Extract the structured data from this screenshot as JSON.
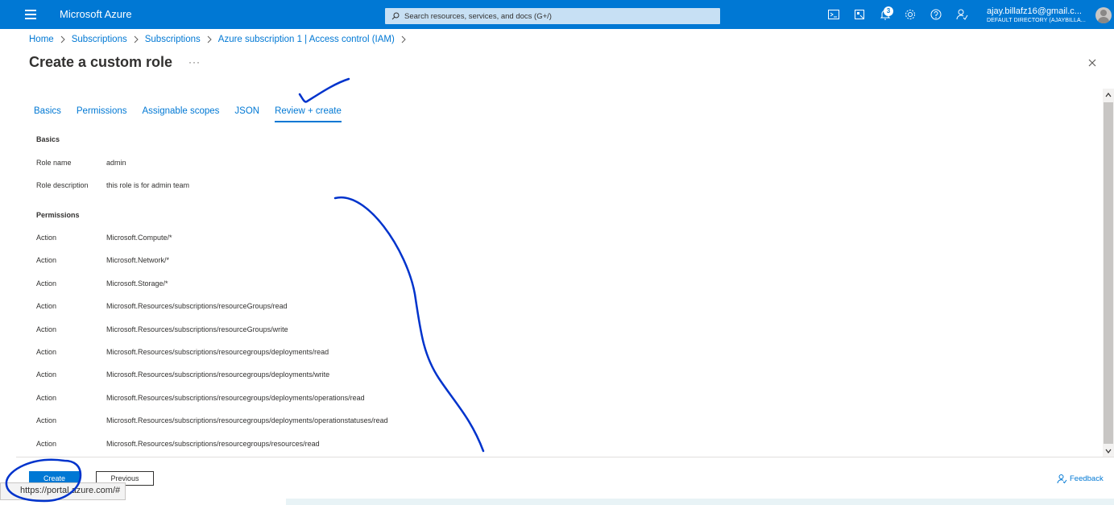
{
  "topbar": {
    "brand": "Microsoft Azure",
    "search_placeholder": "Search resources, services, and docs (G+/)",
    "notification_count": "3",
    "account_email": "ajay.billafz16@gmail.c...",
    "account_directory": "DEFAULT DIRECTORY (AJAYBILLA...",
    "icons": [
      "menu-icon",
      "search-icon",
      "cloud-shell-icon",
      "directory-filter-icon",
      "bell-icon",
      "gear-icon",
      "help-icon",
      "feedback-person-icon",
      "avatar"
    ]
  },
  "breadcrumb": [
    "Home",
    "Subscriptions",
    "Subscriptions",
    "Azure subscription 1 | Access control (IAM)"
  ],
  "page": {
    "title": "Create a custom role",
    "more": "···"
  },
  "tabs": [
    {
      "label": "Basics",
      "active": false
    },
    {
      "label": "Permissions",
      "active": false
    },
    {
      "label": "Assignable scopes",
      "active": false
    },
    {
      "label": "JSON",
      "active": false
    },
    {
      "label": "Review + create",
      "active": true
    }
  ],
  "basics": {
    "heading": "Basics",
    "rows": [
      {
        "label": "Role name",
        "value": "admin"
      },
      {
        "label": "Role description",
        "value": "this role is for admin team"
      }
    ]
  },
  "permissions": {
    "heading": "Permissions",
    "rows": [
      {
        "label": "Action",
        "value": "Microsoft.Compute/*"
      },
      {
        "label": "Action",
        "value": "Microsoft.Network/*"
      },
      {
        "label": "Action",
        "value": "Microsoft.Storage/*"
      },
      {
        "label": "Action",
        "value": "Microsoft.Resources/subscriptions/resourceGroups/read"
      },
      {
        "label": "Action",
        "value": "Microsoft.Resources/subscriptions/resourceGroups/write"
      },
      {
        "label": "Action",
        "value": "Microsoft.Resources/subscriptions/resourcegroups/deployments/read"
      },
      {
        "label": "Action",
        "value": "Microsoft.Resources/subscriptions/resourcegroups/deployments/write"
      },
      {
        "label": "Action",
        "value": "Microsoft.Resources/subscriptions/resourcegroups/deployments/operations/read"
      },
      {
        "label": "Action",
        "value": "Microsoft.Resources/subscriptions/resourcegroups/deployments/operationstatuses/read"
      },
      {
        "label": "Action",
        "value": "Microsoft.Resources/subscriptions/resourcegroups/resources/read"
      }
    ]
  },
  "footer": {
    "create_label": "Create",
    "previous_label": "Previous",
    "feedback_label": "Feedback",
    "status_url": "https://portal.azure.com/#"
  },
  "colors": {
    "accent": "#0078d4",
    "annotation_ink": "#0033cc"
  }
}
